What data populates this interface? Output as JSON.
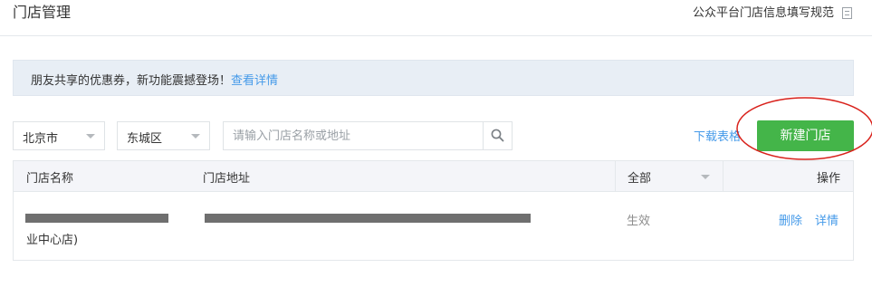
{
  "header": {
    "title": "门店管理",
    "spec_link": "公众平台门店信息填写规范",
    "spec_icon": "document-icon"
  },
  "notice": {
    "text": "朋友共享的优惠券，新功能震撼登场！",
    "link": "查看详情"
  },
  "filters": {
    "city": "北京市",
    "district": "东城区",
    "search_placeholder": "请输入门店名称或地址",
    "search_icon": "search-icon"
  },
  "actions": {
    "download": "下载表格",
    "new_store": "新建门店"
  },
  "table": {
    "headers": {
      "name": "门店名称",
      "address": "门店地址",
      "status": "全部",
      "ops": "操作"
    },
    "rows": [
      {
        "name_visible": "业中心店)",
        "status": "生效",
        "delete": "删除",
        "detail": "详情"
      }
    ]
  },
  "colors": {
    "accent_green": "#44b549",
    "link_blue": "#459ae9",
    "notice_bg": "#e8eef5",
    "annotation_red": "#d9221c"
  }
}
